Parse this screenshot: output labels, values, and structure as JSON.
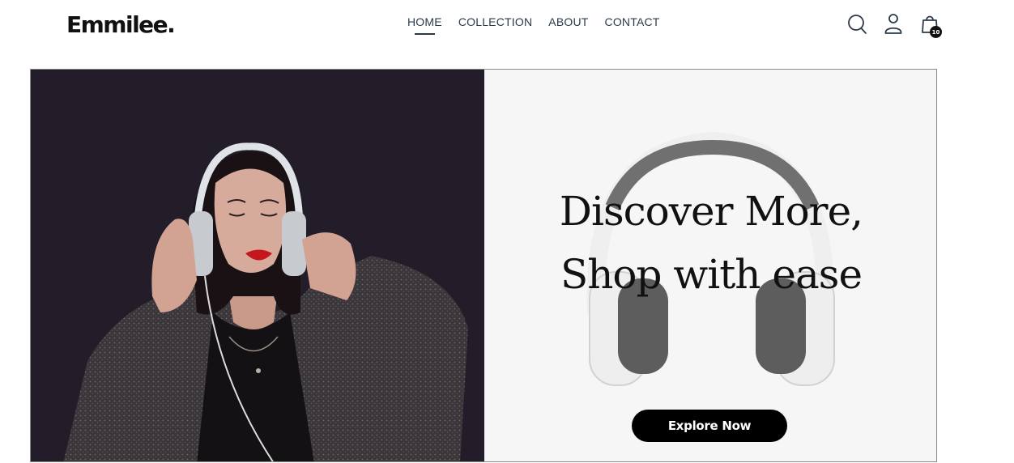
{
  "brand": {
    "logo": "Emmilee."
  },
  "nav": {
    "items": [
      {
        "label": "HOME",
        "active": true
      },
      {
        "label": "COLLECTION",
        "active": false
      },
      {
        "label": "ABOUT",
        "active": false
      },
      {
        "label": "CONTACT",
        "active": false
      }
    ]
  },
  "header_icons": {
    "search": "search-icon",
    "account": "user-icon",
    "cart": "shopping-bag-icon",
    "cart_count": "10"
  },
  "hero": {
    "headline_line1": "Discover More,",
    "headline_line2": "Shop with ease",
    "cta_label": "Explore Now",
    "left_image": "woman-with-headphones-photo",
    "right_image": "white-headphones-photo"
  },
  "colors": {
    "nav_text": "#2b3a4a",
    "hero_left_bg": "#231c29",
    "hero_right_bg": "#f6f6f6",
    "cta_bg": "#000000",
    "cta_text": "#ffffff"
  }
}
